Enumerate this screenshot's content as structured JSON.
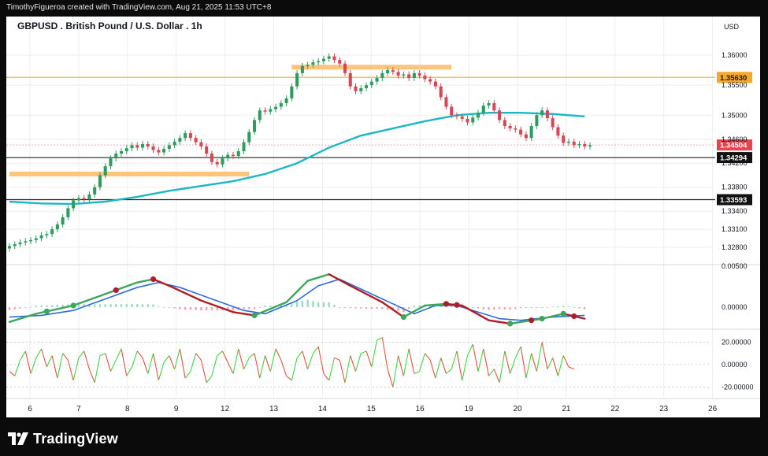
{
  "header": {
    "credit": "TimothyFigueroa created with TradingView.com, Aug 21, 2025 11:53 UTC+8"
  },
  "footer": {
    "brand": "TradingView"
  },
  "chart_data": {
    "type": "candlestick",
    "title": "GBPUSD . British Pound / U.S. Dollar . 1h",
    "currency": "USD",
    "x_ticks": [
      "6",
      "7",
      "8",
      "9",
      "12",
      "13",
      "14",
      "15",
      "16",
      "19",
      "20",
      "21",
      "22",
      "23",
      "26"
    ],
    "price_panel": {
      "y_ticks": [
        "1.36000",
        "1.35500",
        "1.35000",
        "1.34600",
        "1.34200",
        "1.33800",
        "1.33400",
        "1.33100",
        "1.32800"
      ],
      "ylim": [
        1.3255,
        1.3625
      ],
      "candles_close": [
        1.3282,
        1.3285,
        1.3288,
        1.329,
        1.3292,
        1.3295,
        1.33,
        1.3302,
        1.331,
        1.3318,
        1.333,
        1.3345,
        1.3358,
        1.3362,
        1.336,
        1.3368,
        1.338,
        1.34,
        1.3415,
        1.3428,
        1.3436,
        1.344,
        1.3445,
        1.345,
        1.3446,
        1.3452,
        1.3448,
        1.3442,
        1.3438,
        1.3444,
        1.345,
        1.3456,
        1.3462,
        1.347,
        1.3462,
        1.3455,
        1.3448,
        1.3436,
        1.3422,
        1.3418,
        1.3428,
        1.3434,
        1.3432,
        1.344,
        1.3455,
        1.3472,
        1.3492,
        1.3508,
        1.3506,
        1.351,
        1.3514,
        1.352,
        1.3528,
        1.3548,
        1.357,
        1.3582,
        1.3584,
        1.3588,
        1.359,
        1.3594,
        1.3598,
        1.3592,
        1.3586,
        1.357,
        1.3548,
        1.354,
        1.3545,
        1.355,
        1.3556,
        1.3562,
        1.357,
        1.3575,
        1.3572,
        1.3566,
        1.3568,
        1.3562,
        1.357,
        1.3566,
        1.356,
        1.3556,
        1.3548,
        1.353,
        1.3514,
        1.35,
        1.3498,
        1.3494,
        1.3488,
        1.3496,
        1.3504,
        1.3516,
        1.352,
        1.3508,
        1.3492,
        1.3482,
        1.3478,
        1.3476,
        1.3468,
        1.3462,
        1.3482,
        1.35,
        1.3508,
        1.3495,
        1.348,
        1.3466,
        1.3454,
        1.3456,
        1.345,
        1.3452,
        1.3448,
        1.345
      ],
      "ma200": {
        "color": "#1bb8c4",
        "points": [
          [
            0,
            1.3356
          ],
          [
            6,
            1.3353
          ],
          [
            12,
            1.3352
          ],
          [
            18,
            1.3356
          ],
          [
            24,
            1.3364
          ],
          [
            30,
            1.3374
          ],
          [
            36,
            1.3382
          ],
          [
            42,
            1.339
          ],
          [
            48,
            1.3402
          ],
          [
            54,
            1.342
          ],
          [
            60,
            1.3446
          ],
          [
            66,
            1.3466
          ],
          [
            72,
            1.3478
          ],
          [
            78,
            1.349
          ],
          [
            84,
            1.35
          ],
          [
            90,
            1.3504
          ],
          [
            96,
            1.3504
          ],
          [
            102,
            1.3502
          ],
          [
            108,
            1.3498
          ]
        ]
      },
      "zones": [
        {
          "price": 1.358,
          "from": 53,
          "to": 83,
          "color": "#ffc37a"
        },
        {
          "price": 1.3402,
          "from": 0,
          "to": 45,
          "color": "#ffc37a"
        }
      ],
      "levels": [
        {
          "price": 1.3563,
          "label": "1.35630",
          "color": "#f6b33a",
          "label_bg": "#f6a82b",
          "label_fg": "#1a1a1a"
        },
        {
          "price": 1.34294,
          "label": "1.34294",
          "color": "#222222",
          "label_bg": "#111111",
          "label_fg": "#ffffff"
        },
        {
          "price": 1.33593,
          "label": "1.33593",
          "color": "#222222",
          "label_bg": "#111111",
          "label_fg": "#ffffff"
        }
      ],
      "last_price": {
        "price": 1.34504,
        "label": "1.34504",
        "label_bg": "#e8434f",
        "label_fg": "#ffffff"
      }
    },
    "macd_panel": {
      "y_ticks": [
        "0.00500",
        "0.00000"
      ],
      "ylim": [
        -0.0022,
        0.0045
      ],
      "macd_points": [
        [
          0,
          -0.0018
        ],
        [
          5,
          -0.0008
        ],
        [
          12,
          0.0002
        ],
        [
          18,
          0.0016
        ],
        [
          24,
          0.003
        ],
        [
          27,
          0.0034
        ],
        [
          30,
          0.0026
        ],
        [
          36,
          0.0008
        ],
        [
          42,
          -0.0006
        ],
        [
          46,
          -0.001
        ],
        [
          52,
          0.0006
        ],
        [
          56,
          0.0032
        ],
        [
          60,
          0.004
        ],
        [
          64,
          0.0026
        ],
        [
          70,
          0.0006
        ],
        [
          74,
          -0.0012
        ],
        [
          78,
          0.0002
        ],
        [
          82,
          0.0004
        ],
        [
          85,
          0.0002
        ],
        [
          90,
          -0.0016
        ],
        [
          94,
          -0.002
        ],
        [
          100,
          -0.0014
        ],
        [
          104,
          -0.0008
        ],
        [
          108,
          -0.0014
        ]
      ],
      "signal_points": [
        [
          0,
          -0.0012
        ],
        [
          6,
          -0.001
        ],
        [
          12,
          -0.0004
        ],
        [
          18,
          0.001
        ],
        [
          24,
          0.0024
        ],
        [
          28,
          0.003
        ],
        [
          32,
          0.0024
        ],
        [
          38,
          0.001
        ],
        [
          44,
          -0.0004
        ],
        [
          48,
          -0.0008
        ],
        [
          54,
          0.0008
        ],
        [
          58,
          0.0026
        ],
        [
          62,
          0.0034
        ],
        [
          66,
          0.0022
        ],
        [
          72,
          0.0004
        ],
        [
          76,
          -0.0008
        ],
        [
          80,
          0.0002
        ],
        [
          84,
          0.0002
        ],
        [
          88,
          -0.0006
        ],
        [
          92,
          -0.0014
        ],
        [
          96,
          -0.0016
        ],
        [
          102,
          -0.0012
        ],
        [
          108,
          -0.001
        ]
      ],
      "cross_points_green": [
        7,
        12,
        46,
        74,
        94,
        100,
        104
      ],
      "cross_points_red": [
        20,
        27,
        82,
        84,
        98,
        106
      ]
    },
    "osc_panel": {
      "y_ticks": [
        "20.00000",
        "0.00000",
        "-20.00000"
      ],
      "ylim": [
        -28,
        28
      ],
      "values": [
        -6,
        -10,
        4,
        12,
        -8,
        6,
        14,
        -2,
        8,
        -12,
        10,
        4,
        -14,
        6,
        12,
        -4,
        -16,
        8,
        10,
        -6,
        4,
        14,
        -10,
        -2,
        12,
        6,
        -8,
        10,
        -14,
        2,
        8,
        -4,
        14,
        -12,
        -6,
        10,
        4,
        -16,
        -10,
        8,
        12,
        2,
        -8,
        14,
        -4,
        6,
        10,
        -12,
        8,
        -6,
        14,
        4,
        -10,
        -14,
        6,
        12,
        -4,
        10,
        16,
        -8,
        -14,
        6,
        4,
        -16,
        8,
        -6,
        10,
        12,
        -2,
        22,
        24,
        -4,
        -20,
        8,
        -10,
        14,
        -8,
        -6,
        10,
        4,
        -12,
        6,
        -8,
        -4,
        12,
        -14,
        8,
        18,
        -6,
        14,
        -10,
        -4,
        -16,
        12,
        -8,
        6,
        16,
        -12,
        10,
        -6,
        20,
        -4,
        6,
        -10,
        8,
        -2,
        -4
      ]
    },
    "colors": {
      "background": "#ffffff",
      "grid": "#eeeeee",
      "candle_up": "#2e9c5e",
      "candle_down": "#d84655",
      "macd_up": "#3ca65a",
      "macd_down": "#b01d26",
      "signal_line": "#2d6bd9",
      "osc_up": "#41d441",
      "osc_down": "#e5513f"
    }
  }
}
